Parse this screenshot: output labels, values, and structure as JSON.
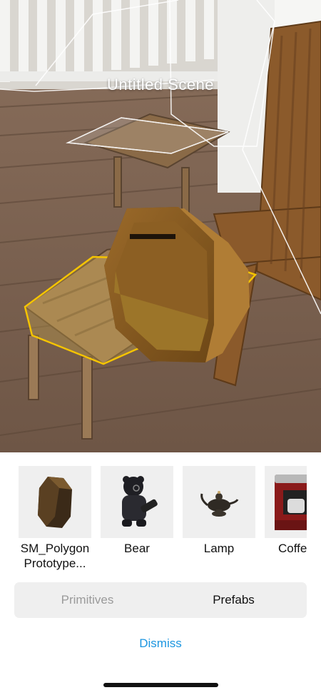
{
  "scene": {
    "title": "Untitled Scene"
  },
  "prefabs": [
    {
      "label": "SM_Polygon Prototype...",
      "icon": "octagon-model-icon"
    },
    {
      "label": "Bear",
      "icon": "bear-model-icon"
    },
    {
      "label": "Lamp",
      "icon": "oil-lamp-model-icon"
    },
    {
      "label": "Coffeel r",
      "icon": "coffee-machine-model-icon"
    }
  ],
  "tabs": {
    "primitives": "Primitives",
    "prefabs": "Prefabs",
    "selected": "Prefabs"
  },
  "actions": {
    "dismiss": "Dismiss"
  },
  "colors": {
    "accent": "#1b95e0",
    "selection_outline": "#f5c400"
  }
}
